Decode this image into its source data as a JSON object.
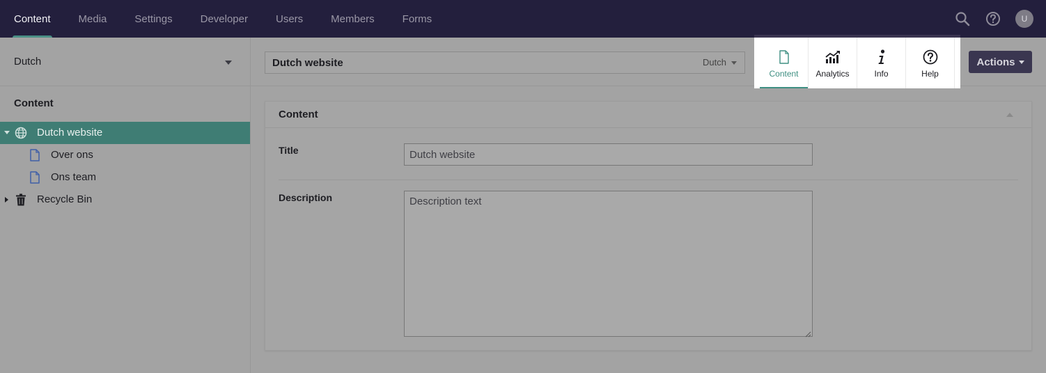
{
  "topnav": {
    "items": [
      {
        "label": "Content",
        "active": true
      },
      {
        "label": "Media"
      },
      {
        "label": "Settings"
      },
      {
        "label": "Developer"
      },
      {
        "label": "Users"
      },
      {
        "label": "Members"
      },
      {
        "label": "Forms"
      }
    ],
    "avatar": "U",
    "tools": [
      "search-icon",
      "help-icon",
      "avatar"
    ]
  },
  "sidebar": {
    "culture": "Dutch",
    "tree_title": "Content",
    "tree": [
      {
        "label": "Dutch website",
        "icon": "globe-icon",
        "selected": true,
        "expanded": true
      },
      {
        "label": "Over ons",
        "icon": "document-icon"
      },
      {
        "label": "Ons team",
        "icon": "document-icon"
      },
      {
        "label": "Recycle Bin",
        "icon": "trash-icon",
        "collapsed": true
      }
    ]
  },
  "editor": {
    "name": "Dutch website",
    "language": "Dutch",
    "apps": [
      {
        "label": "Content",
        "icon": "document-icon",
        "active": true
      },
      {
        "label": "Analytics",
        "icon": "chart-icon"
      },
      {
        "label": "Info",
        "icon": "info-icon"
      },
      {
        "label": "Help",
        "icon": "help-icon"
      }
    ],
    "actions_label": "Actions"
  },
  "panel": {
    "title": "Content",
    "properties": {
      "title_label": "Title",
      "title_value": "Dutch website",
      "description_label": "Description",
      "description_value": "Description text"
    }
  },
  "colors": {
    "topbar": "#231f3d",
    "accent": "#3f8f82",
    "selected_row": "#3f7d74",
    "actions": "#3a3650"
  }
}
